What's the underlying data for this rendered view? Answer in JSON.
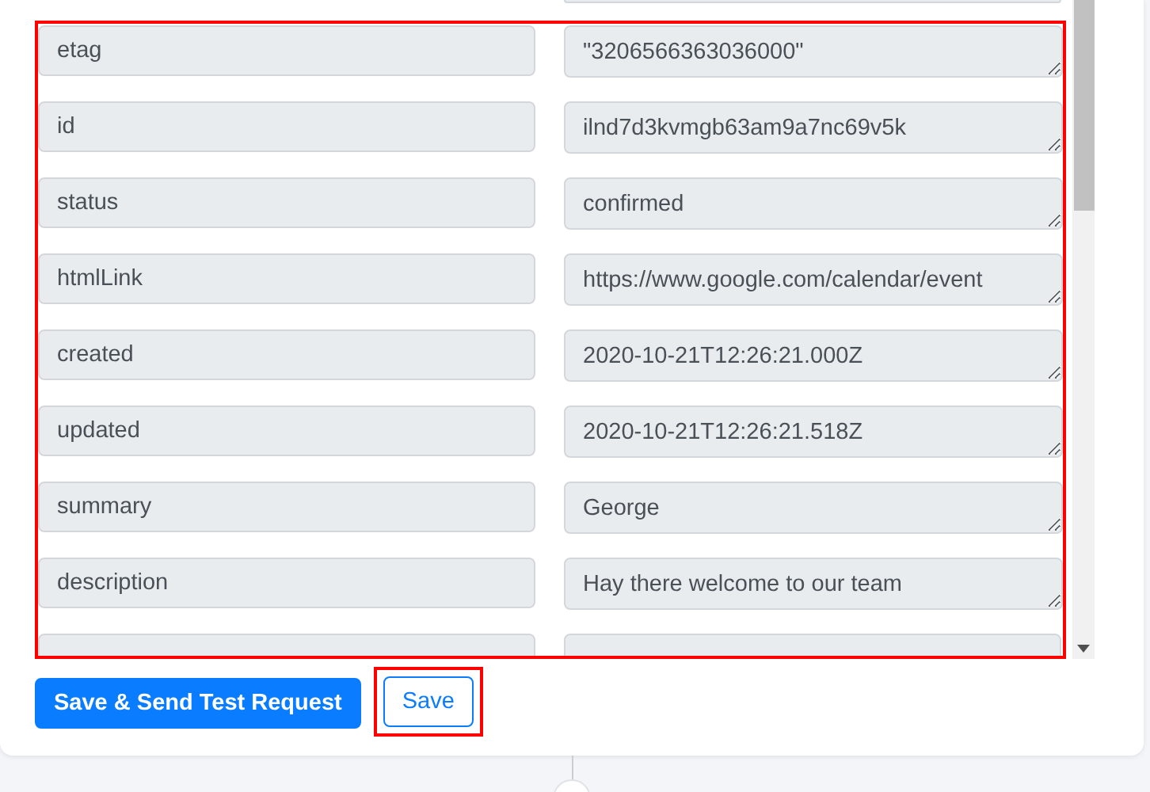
{
  "fields": [
    {
      "key": "etag",
      "value": "\"3206566363036000\""
    },
    {
      "key": "id",
      "value": "ilnd7d3kvmgb63am9a7nc69v5k"
    },
    {
      "key": "status",
      "value": "confirmed"
    },
    {
      "key": "htmlLink",
      "value": "https://www.google.com/calendar/event"
    },
    {
      "key": "created",
      "value": "2020-10-21T12:26:21.000Z"
    },
    {
      "key": "updated",
      "value": "2020-10-21T12:26:21.518Z"
    },
    {
      "key": "summary",
      "value": "George"
    },
    {
      "key": "description",
      "value": "Hay there welcome to our team"
    }
  ],
  "buttons": [
    {
      "label": "Save & Send Test Request",
      "kind": "primary"
    },
    {
      "label": "Save",
      "kind": "outline"
    }
  ]
}
